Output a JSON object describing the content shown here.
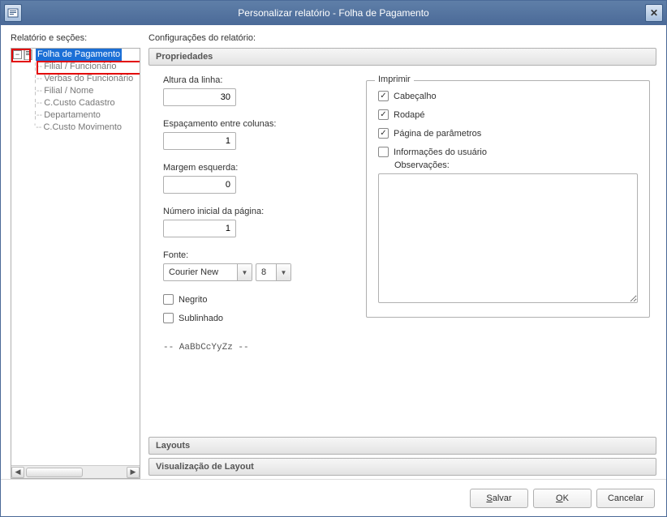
{
  "title": "Personalizar relatório - Folha de Pagamento",
  "left_label": "Relatório e seções:",
  "right_label": "Configurações do relatório:",
  "tree": {
    "root": "Folha de Pagamento",
    "items": [
      "Filial / Funcionário",
      "Verbas do Funcionário",
      "Filial / Nome",
      "C.Custo Cadastro",
      "Departamento",
      "C.Custo Movimento"
    ]
  },
  "sections": {
    "properties": "Propriedades",
    "layouts": "Layouts",
    "preview": "Visualização de Layout"
  },
  "fields": {
    "row_height_label": "Altura da linha:",
    "row_height": "30",
    "col_spacing_label": "Espaçamento entre colunas:",
    "col_spacing": "1",
    "left_margin_label": "Margem esquerda:",
    "left_margin": "0",
    "start_page_label": "Número inicial da página:",
    "start_page": "1",
    "font_label": "Fonte:",
    "font_name": "Courier New",
    "font_size": "8",
    "bold_label": "Negrito",
    "underline_label": "Sublinhado",
    "sample": "-- AaBbCcYyZz --"
  },
  "print": {
    "legend": "Imprimir",
    "header": "Cabeçalho",
    "footer": "Rodapé",
    "params": "Página de parâmetros",
    "userinfo": "Informações do usuário",
    "obs_label": "Observações:"
  },
  "buttons": {
    "save": "Salvar",
    "ok": "OK",
    "cancel": "Cancelar"
  }
}
